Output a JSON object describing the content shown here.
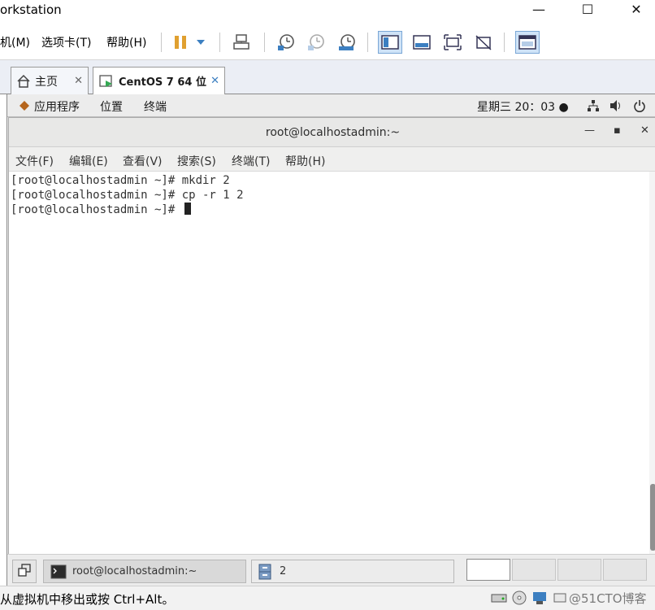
{
  "window": {
    "title": "orkstation",
    "minimize": "—",
    "maximize": "☐",
    "close": "✕"
  },
  "host_menu": {
    "vm": "机(M)",
    "tabs": "选项卡(T)",
    "help": "帮助(H)"
  },
  "toolbar_icons": [
    "pause-icon",
    "dropdown-icon",
    "send-keys-icon",
    "snapshot-icon",
    "revert-snapshot-icon",
    "snapshot-manager-icon",
    "library-view-icon",
    "console-view-icon",
    "fullscreen-icon",
    "unity-icon",
    "thumbnail-icon"
  ],
  "tabs": [
    {
      "label": "主页",
      "close": "✕"
    },
    {
      "label": "CentOS 7 64 位",
      "close": "✕"
    }
  ],
  "gnome_top": {
    "applications": "应用程序",
    "places": "位置",
    "terminal": "终端",
    "clock": "星期三 20：03 ●"
  },
  "terminal": {
    "title": "root@localhostadmin:~",
    "menu": [
      "文件(F)",
      "编辑(E)",
      "查看(V)",
      "搜索(S)",
      "终端(T)",
      "帮助(H)"
    ],
    "lines": [
      "[root@localhostadmin ~]# mkdir 2",
      "[root@localhostadmin ~]# cp -r 1 2",
      "[root@localhostadmin ~]# "
    ]
  },
  "taskbar": {
    "terminal_task": "root@localhostadmin:~",
    "files_task": "2"
  },
  "statusbar": {
    "message": "从虚拟机中移出或按 Ctrl+Alt。",
    "watermark": "@51CTO博客"
  },
  "colors": {
    "accent": "#3c7fc1",
    "pause": "#e0a030",
    "tab_bg": "#ebeef5"
  }
}
